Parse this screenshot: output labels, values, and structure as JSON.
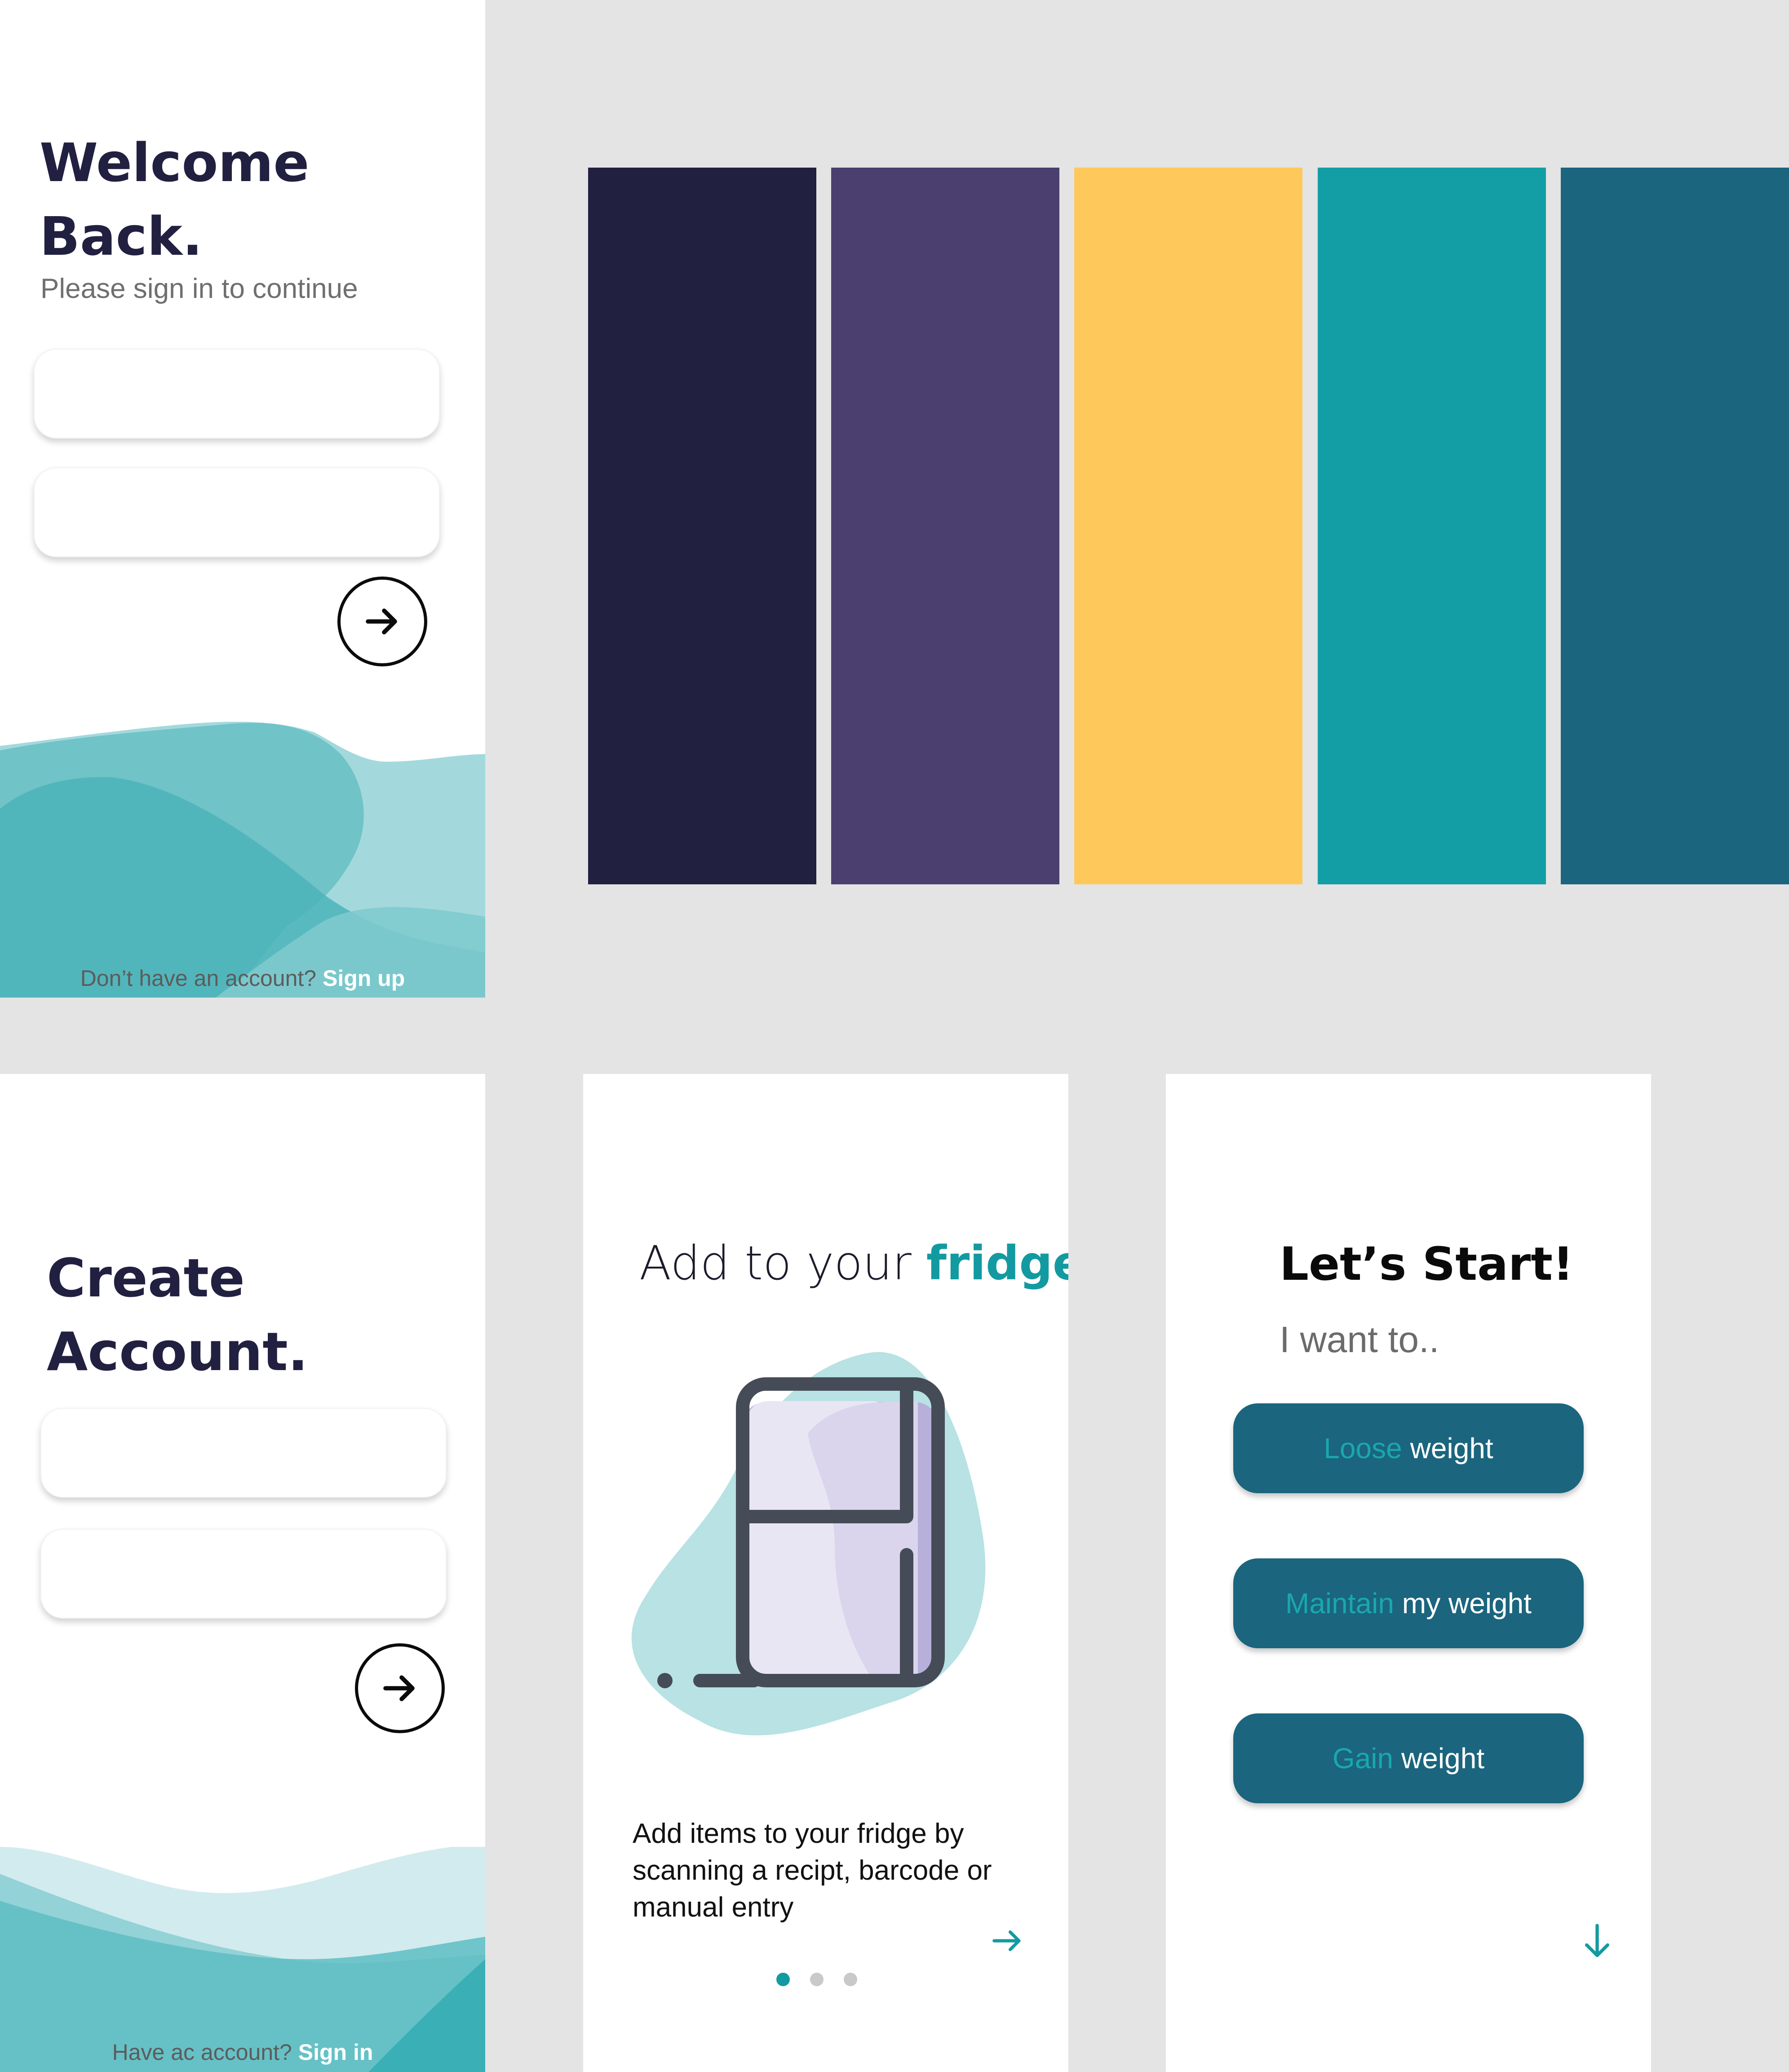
{
  "palette": {
    "colors": [
      "#212040",
      "#4b3f6f",
      "#fec85a",
      "#139ea5",
      "#1b657e"
    ]
  },
  "signin": {
    "title": "Welcome\nBack.",
    "subtitle": "Please sign in to continue",
    "footer_prompt": "Don’t have an account?",
    "footer_link": "Sign up"
  },
  "create_account": {
    "title": "Create\nAccount.",
    "footer_prompt": "Have ac account?",
    "footer_link": "Sign in"
  },
  "fridge": {
    "title_plain": "Add to your",
    "title_highlight": "fridge",
    "description": "Add items to your fridge by scanning a recipt, barcode or manual entry",
    "pagination": {
      "total": 3,
      "active": 1
    }
  },
  "start": {
    "title": "Let’s Start!",
    "subtitle": "I want to..",
    "options": [
      {
        "highlight": "Loose",
        "rest": "weight"
      },
      {
        "highlight": "Maintain",
        "rest": "my weight"
      },
      {
        "highlight": "Gain",
        "rest": "weight"
      }
    ]
  },
  "icons": {
    "next": "arrow-right-icon",
    "scroll": "arrow-down-icon",
    "illustration": "fridge-icon"
  }
}
